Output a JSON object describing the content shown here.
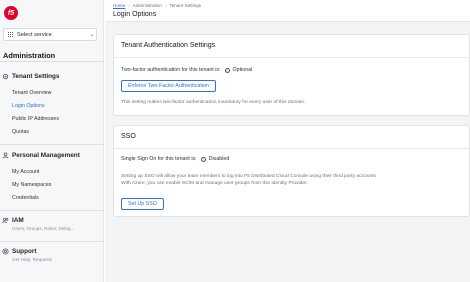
{
  "sidebar": {
    "logo_text": "f5",
    "select_service": "Select service",
    "admin_heading": "Administration",
    "tenant_settings": {
      "label": "Tenant Settings",
      "items": [
        "Tenant Overview",
        "Login Options",
        "Public IP Addresses",
        "Quotas"
      ]
    },
    "personal_management": {
      "label": "Personal Management",
      "items": [
        "My Account",
        "My Namespaces",
        "Credentials"
      ]
    },
    "iam": {
      "label": "IAM",
      "subtitle": "Users, Groups, Roles, Deleg..."
    },
    "support": {
      "label": "Support",
      "subtitle": "Get Help, Requests"
    }
  },
  "breadcrumb": [
    "Home",
    "Administration",
    "Tenant Settings"
  ],
  "page_title": "Login Options",
  "tenant_auth": {
    "title": "Tenant Authentication Settings",
    "status_label": "Two-factor authentication for this tenant is:",
    "status_value": "Optional",
    "button": "Enforce Two-Factor Authentication",
    "description": "This setting makes two-factor authentication mandatory for every user of this domain."
  },
  "sso": {
    "title": "SSO",
    "status_label": "Single Sign On for this tenant is:",
    "status_value": "Disabled",
    "description_1": "Setting up SSO will allow your team members to log into F5 Distributed Cloud Console using their third party accounts",
    "description_2": "With Azure, you can enable SCIM and manage user groups from this Identity Provider.",
    "button": "Set Up SSO"
  },
  "colors": {
    "accent": "#2f6fde",
    "brand": "#e4002b"
  }
}
